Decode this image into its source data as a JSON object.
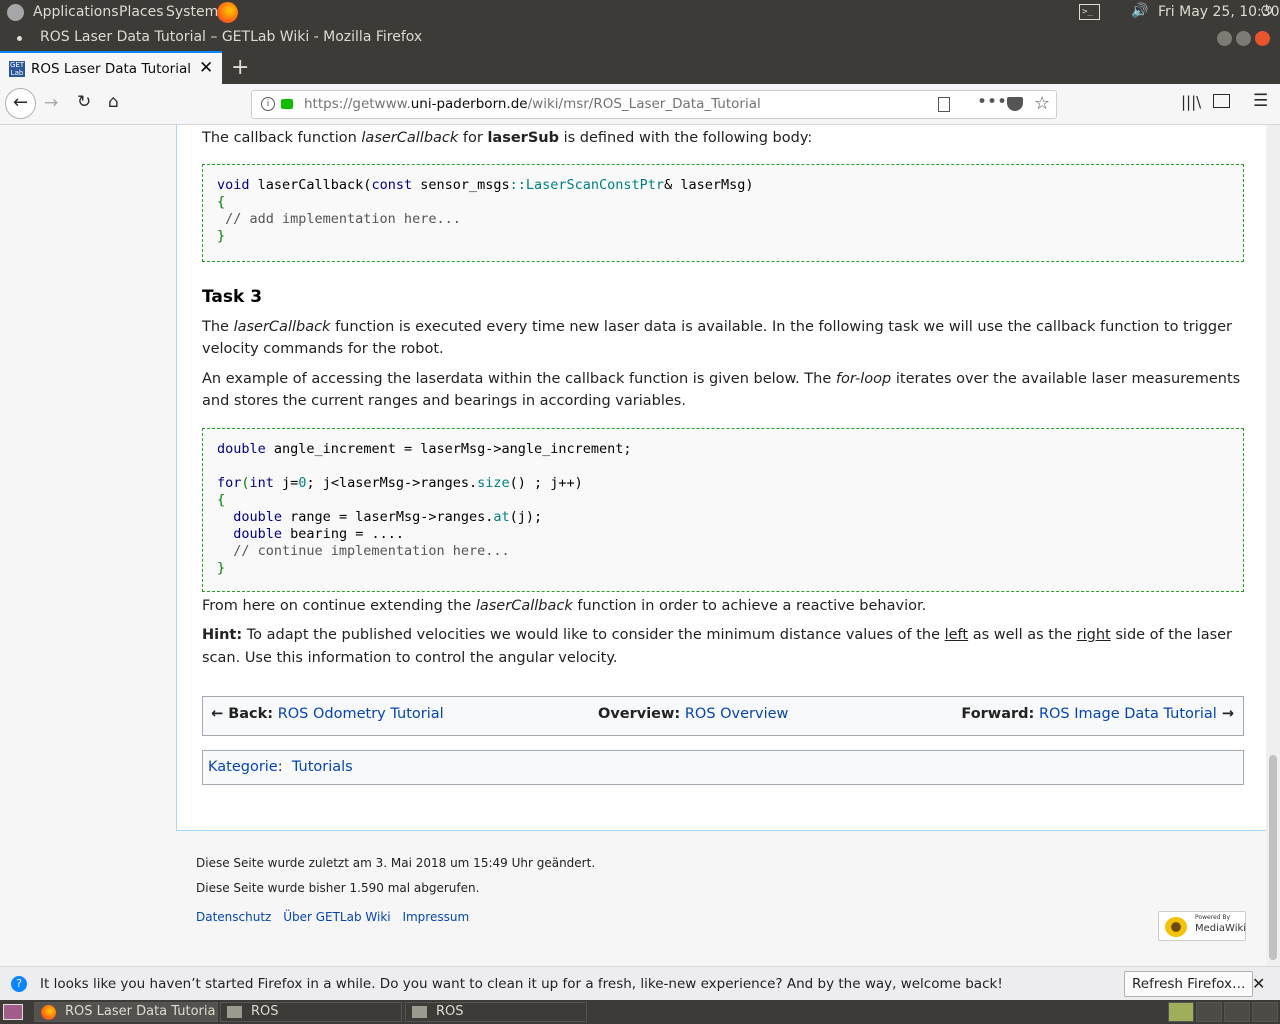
{
  "system_bar": {
    "applications": "Applications",
    "places": "Places",
    "system": "System",
    "clock": "Fri May 25, 10:30"
  },
  "window": {
    "title": "ROS Laser Data Tutorial – GETLab Wiki - Mozilla Firefox"
  },
  "tabs": [
    {
      "label": "ROS Laser Data Tutorial – G"
    }
  ],
  "url": {
    "prefix": "https://getwww.",
    "domain": "uni-paderborn.de",
    "path": "/wiki/msr/ROS_Laser_Data_Tutorial"
  },
  "article": {
    "intro": {
      "pre": "The callback function ",
      "fn": "laserCallback",
      "mid": " for ",
      "sub": "laserSub",
      "post": " is defined with the following body:"
    },
    "code1": {
      "l1_void": "void",
      "l1_fn": " laserCallback(",
      "l1_const": "const",
      "l1_ns": " sensor_msgs",
      "l1_sep": "::",
      "l1_type": "LaserScanConstPtr",
      "l1_rest": "& laserMsg)",
      "l2": "{",
      "l3": " // add implementation here...",
      "l4": "}"
    },
    "task_heading": "Task 3",
    "task_p1": {
      "pre": "The ",
      "fn": "laserCallback",
      "post": " function is executed every time new laser data is available. In the following task we will use the callback function to trigger velocity commands for the robot."
    },
    "task_p2": {
      "pre": "An example of accessing the laserdata within the callback function is given below. The ",
      "fl": "for-loop",
      "post": " iterates over the available laser measurements and stores the current ranges and bearings in according variables."
    },
    "code2": {
      "l1_double": "double",
      "l1_rest": " angle_increment = laserMsg->angle_increment;",
      "l3_for": "for",
      "l3_int": "int",
      "l3_a": " j=",
      "l3_zero": "0",
      "l3_b": "; j<laserMsg->ranges.",
      "l3_size": "size",
      "l3_c": "() ; j++)",
      "l4": "{",
      "l5_double": "double",
      "l5_rest": " range = laserMsg->ranges.",
      "l5_at": "at",
      "l5_end": "(j);",
      "l6_double": "double",
      "l6_rest": " bearing = ....",
      "l7": "// continue implementation here...",
      "l8": "}"
    },
    "continue_p": {
      "pre": "From here on continue extending the ",
      "fn": "laserCallback",
      "post": " function in order to achieve a reactive behavior."
    },
    "hint": {
      "label": "Hint:",
      "pre": " To adapt the published velocities we would like to consider the minimum distance values of the ",
      "left": "left",
      "mid": " as well as the ",
      "right": "right",
      "post": " side of the laser scan. Use this information to control the angular velocity."
    },
    "nav": {
      "back_label": "← Back:",
      "back_link": "ROS Odometry Tutorial",
      "overview_label": "Overview:",
      "overview_link": "ROS Overview",
      "forward_label": "Forward:",
      "forward_link": "ROS Image Data Tutorial",
      "forward_arrow": " →"
    },
    "category": {
      "label": "Kategorie",
      "sep": ":",
      "value": "Tutorials"
    }
  },
  "footer": {
    "modified": "Diese Seite wurde zuletzt am 3. Mai 2018 um 15:49 Uhr geändert.",
    "views": "Diese Seite wurde bisher 1.590 mal abgerufen.",
    "links": [
      "Datenschutz",
      "Über GETLab Wiki",
      "Impressum"
    ],
    "powered_top": "Powered By",
    "powered_bottom": "MediaWiki"
  },
  "notification": {
    "text": "It looks like you haven’t started Firefox in a while. Do you want to clean it up for a fresh, like-new experience? And by the way, welcome back!",
    "button": "Refresh Firefox…"
  },
  "taskbar": {
    "items": [
      "ROS Laser Data Tutoria...",
      "ROS",
      "ROS"
    ]
  }
}
